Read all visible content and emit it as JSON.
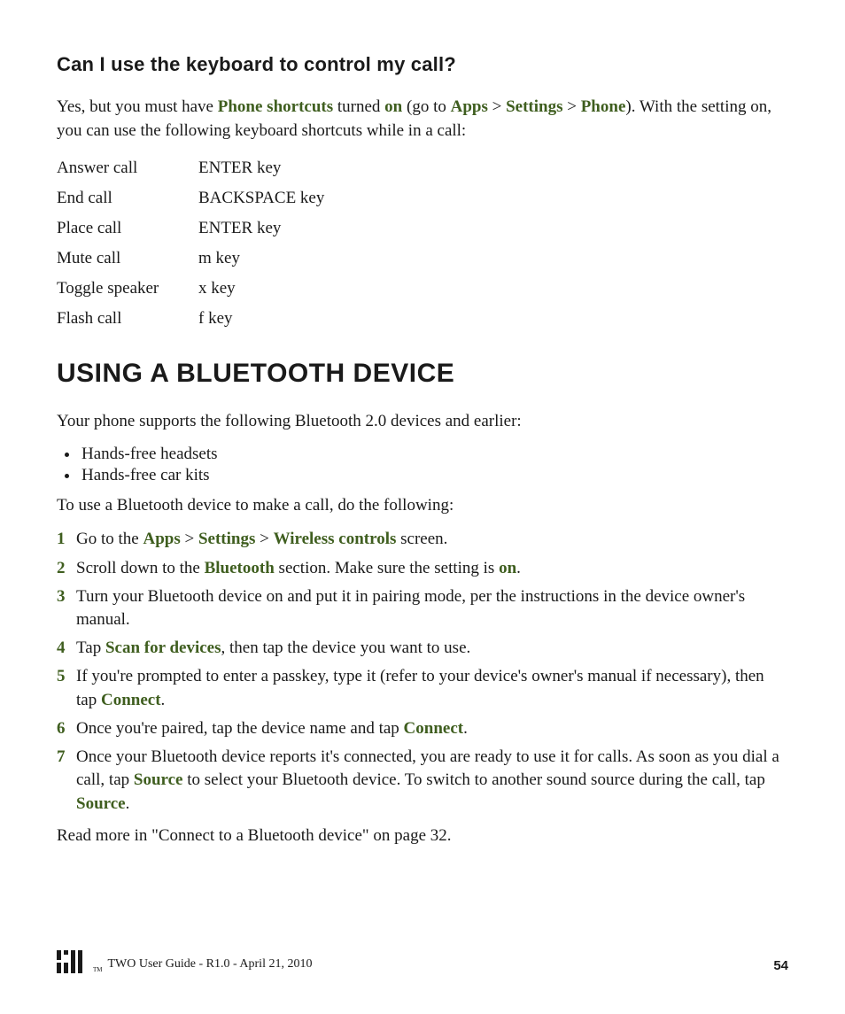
{
  "section1": {
    "heading": "Can I use the keyboard to control my call?",
    "para_parts": {
      "p1": "Yes, but you must have ",
      "p2": "Phone shortcuts",
      "p3": " turned ",
      "p4": "on",
      "p5": " (go to ",
      "p6": "Apps",
      "p7": " > ",
      "p8": "Settings",
      "p9": " > ",
      "p10": "Phone",
      "p11": "). With the setting on, you can use the following keyboard shortcuts while in a call:"
    },
    "shortcuts": [
      {
        "action": "Answer call",
        "key": "ENTER key"
      },
      {
        "action": "End call",
        "key": "BACKSPACE key"
      },
      {
        "action": "Place call",
        "key": "ENTER key"
      },
      {
        "action": "Mute call",
        "key": "m key"
      },
      {
        "action": "Toggle speaker",
        "key": "x key"
      },
      {
        "action": "Flash call",
        "key": "f key"
      }
    ]
  },
  "section2": {
    "heading": "USING A BLUETOOTH DEVICE",
    "intro": "Your phone supports the following Bluetooth 2.0 devices and earlier:",
    "bullets": [
      "Hands-free headsets",
      "Hands-free car kits"
    ],
    "lead": "To use a Bluetooth device to make a call, do the following:",
    "steps": {
      "s1": {
        "a": "Go to the ",
        "b": "Apps",
        "c": " > ",
        "d": "Settings",
        "e": " > ",
        "f": "Wireless controls",
        "g": " screen."
      },
      "s2": {
        "a": "Scroll down to the ",
        "b": "Bluetooth",
        "c": " section. Make sure the setting is ",
        "d": "on",
        "e": "."
      },
      "s3": {
        "a": "Turn your Bluetooth device on and put it in pairing mode, per the instructions in the device owner's manual."
      },
      "s4": {
        "a": "Tap ",
        "b": "Scan for devices",
        "c": ", then tap the device you want to use."
      },
      "s5": {
        "a": "If you're prompted to enter a passkey, type it (refer to your device's owner's manual if necessary), then tap ",
        "b": "Connect",
        "c": "."
      },
      "s6": {
        "a": "Once you're paired, tap the device name and tap ",
        "b": "Connect",
        "c": "."
      },
      "s7": {
        "a": "Once your Bluetooth device reports it's connected, you are ready to use it for calls. As soon as you dial a call, tap ",
        "b": "Source",
        "c": " to select your Bluetooth device. To switch to another sound source during the call, tap ",
        "d": "Source",
        "e": "."
      }
    },
    "outro": "Read more in \"Connect to a Bluetooth device\" on page 32."
  },
  "footer": {
    "text": "TWO User Guide - R1.0 - April 21, 2010",
    "page": "54",
    "tm": "TM"
  }
}
